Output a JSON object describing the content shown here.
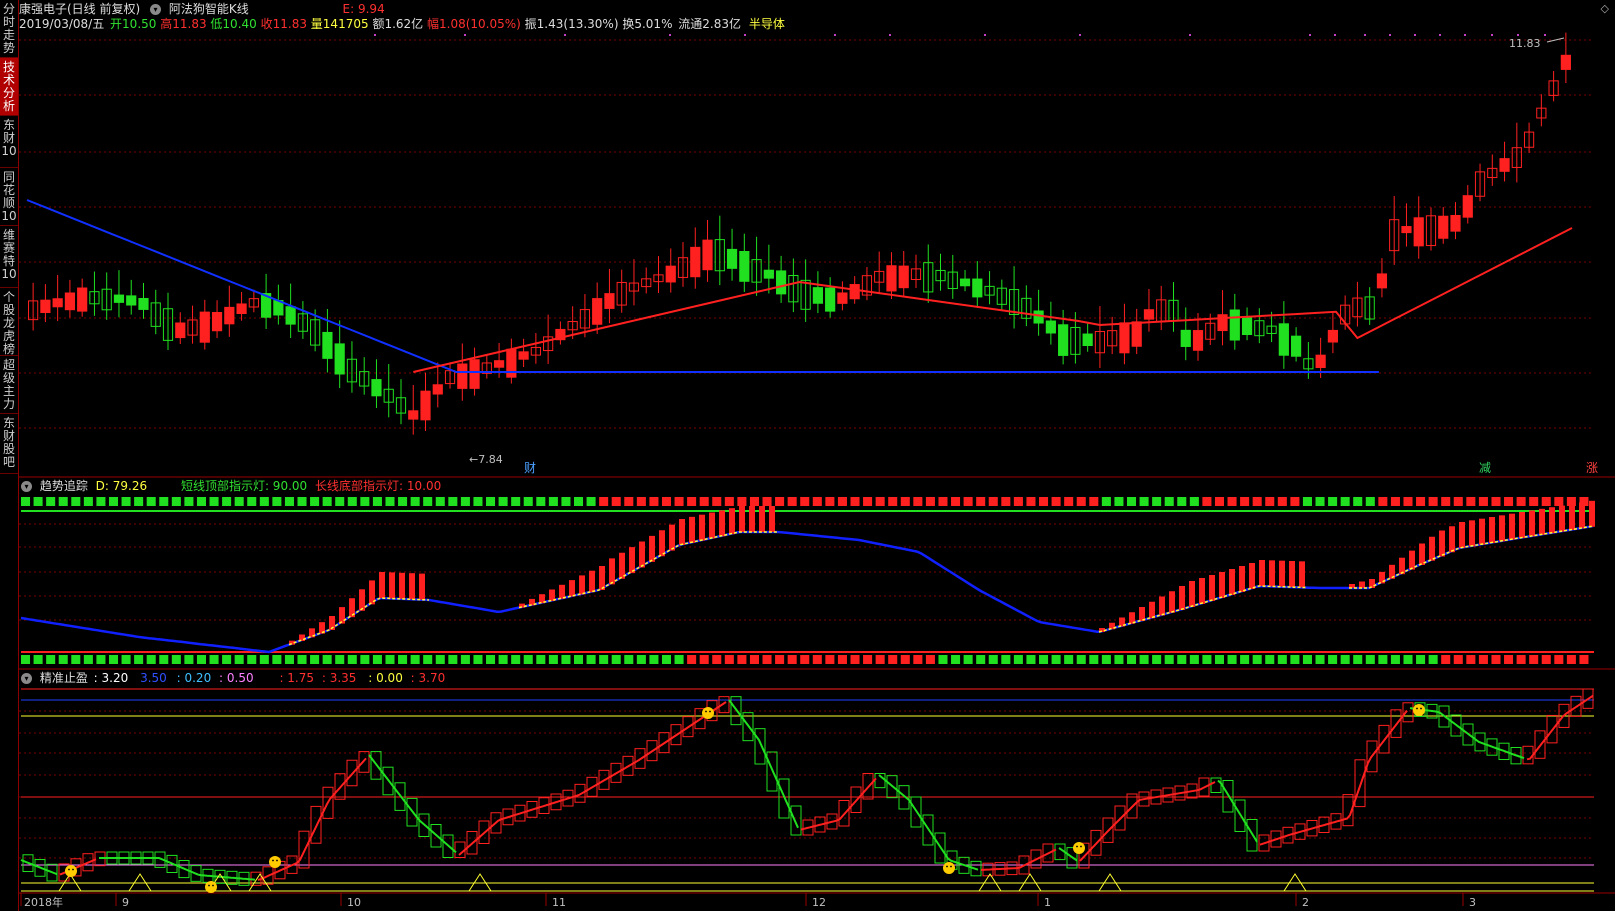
{
  "sidebar": {
    "tabs": [
      {
        "id": "fenshi",
        "label": "分时走势",
        "active": false
      },
      {
        "id": "jishu",
        "label": "技术分析",
        "active": true
      },
      {
        "id": "dongcai10",
        "label": "东财10",
        "active": false
      },
      {
        "id": "tonghuashun10",
        "label": "同花顺10",
        "active": false
      },
      {
        "id": "weisaite10",
        "label": "维赛特10",
        "active": false
      },
      {
        "id": "gegu",
        "label": "个股龙虎榜",
        "active": false
      },
      {
        "id": "chaoji",
        "label": "超级主力",
        "active": false
      },
      {
        "id": "guba",
        "label": "东财股吧",
        "active": false
      }
    ]
  },
  "header": {
    "stock": "康强电子(日线 前复权)",
    "indicator": "阿法狗智能K线",
    "e_label": "E: 9.94",
    "date": "2019/03/08/五",
    "open": "开10.50",
    "high": "高11.83",
    "low": "低10.40",
    "close": "收11.83",
    "volume": "量141705",
    "amount": "额1.62亿",
    "change": "幅1.08(10.05%)",
    "amplitude": "振1.43(13.30%)",
    "turnover": "换5.01%",
    "float": "流通2.83亿",
    "sector": "半导体"
  },
  "price_panel": {
    "high_label": "11.83",
    "low_label": "7.84",
    "markers": [
      {
        "text": "财",
        "color": "#4aa0ff"
      },
      {
        "text": "减",
        "color": "#30d060"
      },
      {
        "text": "涨",
        "color": "#ff4040"
      }
    ]
  },
  "trend_panel": {
    "name": "趋势追踪",
    "d_value": "D: 79.26",
    "short_light": "短线顶部指示灯: 90.00",
    "long_light": "长线底部指示灯: 10.00"
  },
  "stop_panel": {
    "name": "精准止盈",
    "values": [
      {
        "text": ": 3.20",
        "color": "#ffffff"
      },
      {
        "text": "3.50",
        "color": "#3050ff"
      },
      {
        "text": ": 0.20",
        "color": "#40c0ff"
      },
      {
        "text": ": 0.50",
        "color": "#ff80ff"
      },
      {
        "text": ": 1.75",
        "color": "#ff3030"
      },
      {
        "text": ": 3.35",
        "color": "#ff3030"
      },
      {
        "text": ": 0.00",
        "color": "#ffff40"
      },
      {
        "text": ": 3.70",
        "color": "#ff3030"
      }
    ]
  },
  "x_axis": {
    "labels": [
      "2018年",
      "9",
      "10",
      "11",
      "12",
      "1",
      "2",
      "3"
    ]
  },
  "colors": {
    "up": "#ff2020",
    "down": "#20e020",
    "ma": "#1030ff",
    "grid": "#7a0000",
    "yellow": "#ffff30"
  }
}
